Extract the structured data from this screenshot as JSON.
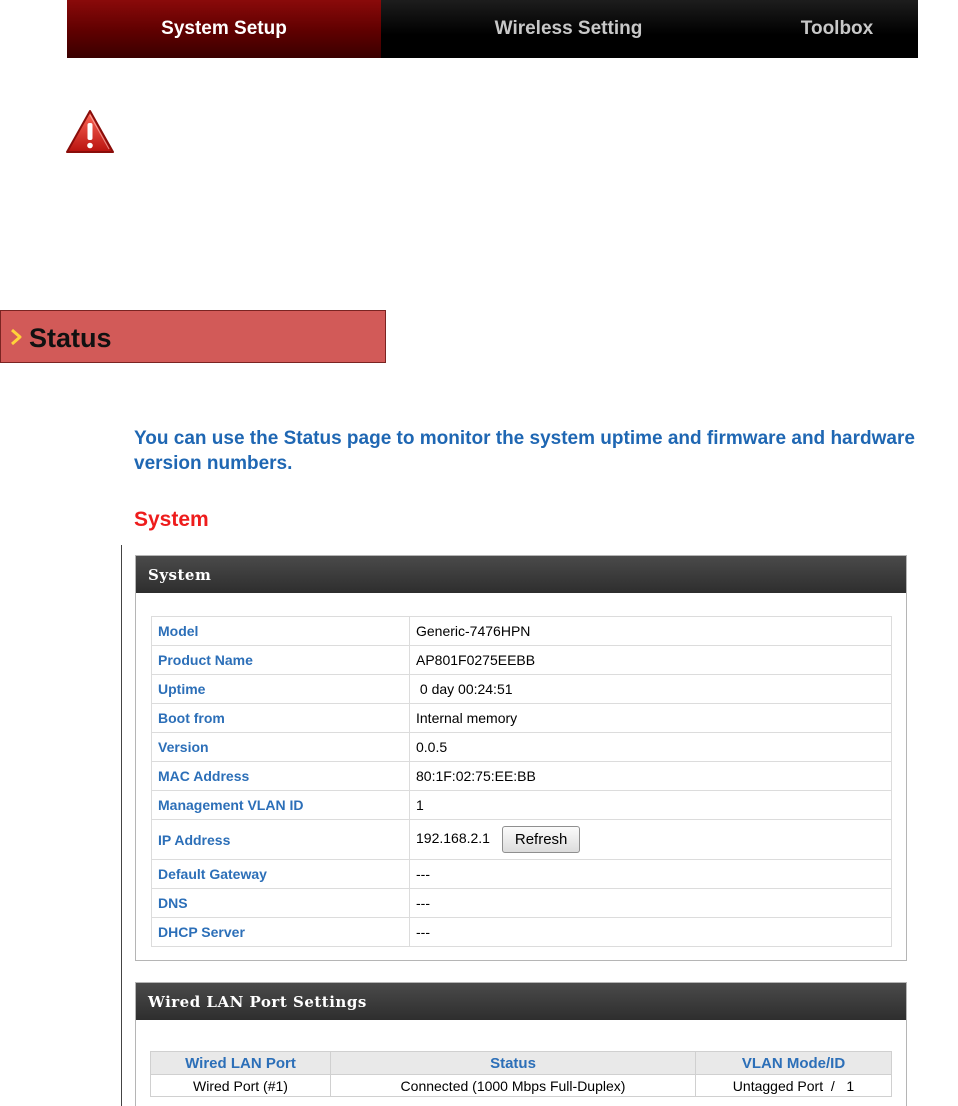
{
  "nav": {
    "tabs": [
      {
        "label": "System Setup"
      },
      {
        "label": "Wireless Setting"
      },
      {
        "label": "Toolbox"
      }
    ]
  },
  "status_banner": {
    "title": "Status"
  },
  "intro": {
    "text": "You can use the Status page to monitor the system uptime and firmware and hardware version numbers."
  },
  "section_heading": "System",
  "system_panel": {
    "title": "System",
    "rows": [
      {
        "key": "Model",
        "value": "Generic-7476HPN"
      },
      {
        "key": "Product Name",
        "value": "AP801F0275EEBB"
      },
      {
        "key": "Uptime",
        "value": " 0 day 00:24:51"
      },
      {
        "key": "Boot from",
        "value": "Internal memory"
      },
      {
        "key": "Version",
        "value": "0.0.5"
      },
      {
        "key": "MAC Address",
        "value": "80:1F:02:75:EE:BB"
      },
      {
        "key": "Management VLAN ID",
        "value": "1"
      },
      {
        "key": "IP Address",
        "value": "192.168.2.1"
      },
      {
        "key": "Default Gateway",
        "value": "---"
      },
      {
        "key": "DNS",
        "value": "---"
      },
      {
        "key": "DHCP Server",
        "value": "---"
      }
    ],
    "refresh_label": "Refresh"
  },
  "wired_panel": {
    "title": "Wired LAN Port Settings",
    "headers": [
      "Wired LAN Port",
      "Status",
      "VLAN Mode/ID"
    ],
    "rows": [
      [
        "Wired Port (#1)",
        "Connected (1000 Mbps Full-Duplex)",
        "Untagged Port  /   1"
      ]
    ]
  },
  "colors": {
    "nav_active": "#6e0000",
    "banner": "#d25a58",
    "intro_text": "#1f67b3",
    "heading": "#ee1c1c",
    "key_text": "#2c6fb8"
  }
}
